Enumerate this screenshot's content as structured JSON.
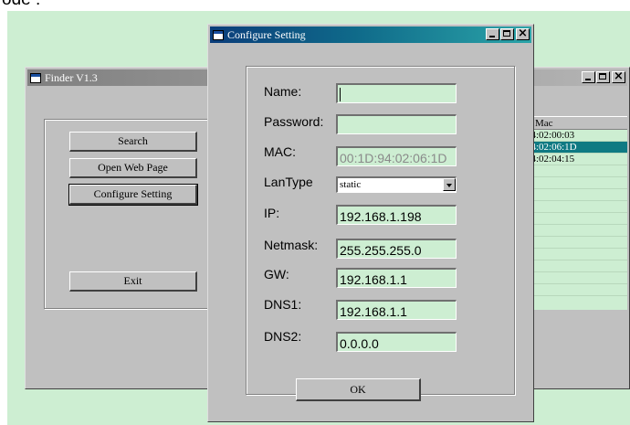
{
  "top_caption": "ode :",
  "finder": {
    "title": "Finder V1.3",
    "buttons": {
      "search": "Search",
      "open_web_page": "Open Web Page",
      "configure_setting": "Configure Setting",
      "exit": "Exit"
    },
    "mac_column_header": "Mac",
    "mac_rows": [
      "94:02:00:03",
      "94:02:06:1D",
      "94:02:04:15",
      "",
      "",
      "",
      "",
      "",
      "",
      "",
      "",
      "",
      "",
      "",
      ""
    ],
    "selected_row_index": 1
  },
  "dialog": {
    "title": "Configure Setting",
    "fields": {
      "name_label": "Name:",
      "name_value": "",
      "password_label": "Password:",
      "password_value": "",
      "mac_label": "MAC:",
      "mac_value": "00:1D:94:02:06:1D",
      "lantype_label": "LanType",
      "lantype_value": "static",
      "ip_label": "IP:",
      "ip_value": "192.168.1.198",
      "netmask_label": "Netmask:",
      "netmask_value": "255.255.255.0",
      "gw_label": "GW:",
      "gw_value": "192.168.1.1",
      "dns1_label": "DNS1:",
      "dns1_value": "192.168.1.1",
      "dns2_label": "DNS2:",
      "dns2_value": "0.0.0.0"
    },
    "ok_label": "OK"
  },
  "colors": {
    "desktop": "#cdeed2",
    "field_bg": "#cdeed2",
    "window_face": "#c0c0c0",
    "selection": "#0f7a83"
  },
  "icons": [
    "window-app-icon",
    "minimize-icon",
    "maximize-icon",
    "close-icon",
    "dropdown-arrow-icon"
  ]
}
